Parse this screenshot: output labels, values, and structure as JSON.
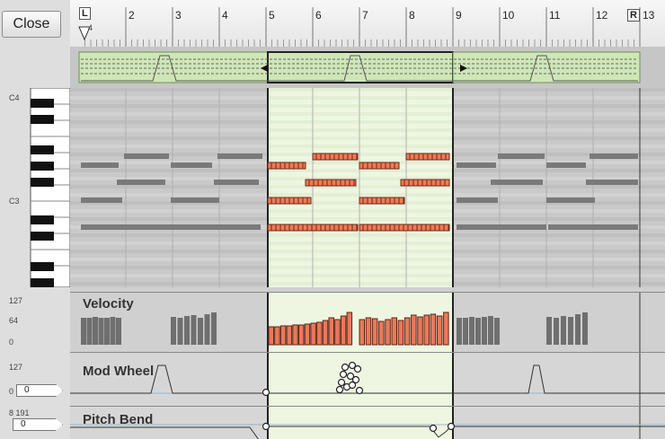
{
  "toolbar": {
    "close_label": "Close"
  },
  "ruler": {
    "bars": [
      "2",
      "3",
      "4",
      "5",
      "6",
      "7",
      "8",
      "9",
      "10",
      "11",
      "12",
      "13"
    ],
    "left_marker": "L",
    "right_marker": "R",
    "sub_label": "4"
  },
  "keyboard": {
    "c4_label": "C4",
    "c3_label": "C3"
  },
  "velocity": {
    "title": "Velocity",
    "max_label": "127",
    "mid_label": "64",
    "min_label": "0"
  },
  "mod_wheel": {
    "title": "Mod Wheel",
    "max_label": "127",
    "min_label": "0",
    "value": "0"
  },
  "pitch_bend": {
    "title": "Pitch Bend",
    "max_label": "8 191",
    "value": "0"
  },
  "colors": {
    "loop_green": "#cfe6b8",
    "note_selected": "#f07a55",
    "note_ghost": "#7a7a7a",
    "selection_bg": "#eef6e2"
  }
}
